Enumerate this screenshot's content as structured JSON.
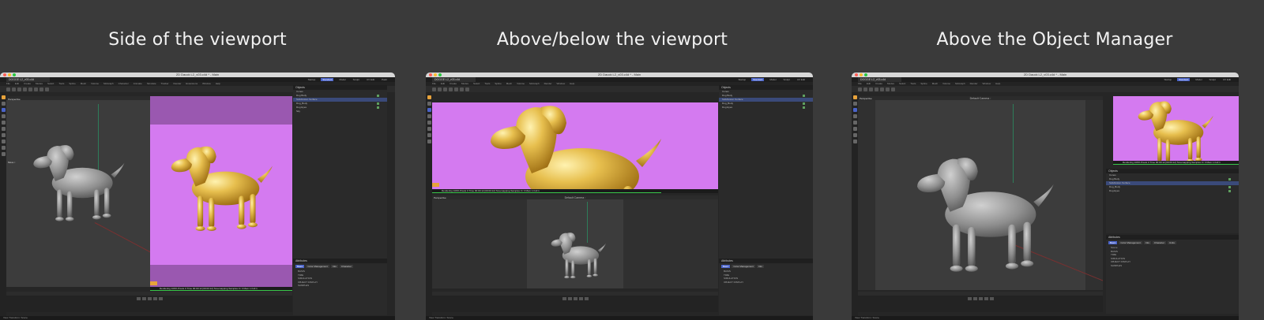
{
  "panels": [
    {
      "caption": "Side of the viewport"
    },
    {
      "caption": "Above/below the viewport"
    },
    {
      "caption": "Above the Object Manager"
    }
  ],
  "app": {
    "window_title": "2D Dauck L2_v03.c4d * - Main",
    "file_tab": "DOGGE L2_v03.c4d",
    "menus": [
      "File",
      "Edit",
      "Create",
      "Modes",
      "Select",
      "Tools",
      "Spline",
      "Mesh",
      "Volume",
      "MoGraph",
      "Character",
      "Animate",
      "Simulate",
      "Tracker",
      "Render",
      "Extensions",
      "Window",
      "Help"
    ],
    "layouts": [
      "Startup",
      "Standard",
      "Model",
      "Sculpt",
      "UV Edit",
      "Paint",
      "Groom",
      "Track",
      "Script",
      "Nodes"
    ],
    "active_layout": "Standard"
  },
  "viewport": {
    "view_label": "Perspective",
    "camera_label": "Default Camera ◦",
    "move_label": "Move ↕",
    "status": "View Transform: Scene",
    "grid_spacing": "Grid Spacing : 50 cm"
  },
  "object_manager": {
    "title": "Objects",
    "menus": [
      "File",
      "Edit",
      "View",
      "Object",
      "Tags",
      "Bookmarks"
    ],
    "items": [
      "Cones",
      "Dog Body",
      "Subdivision Surface",
      "Dog_Body",
      "Dog Eyes",
      "Sky"
    ]
  },
  "attributes": {
    "title": "Attributes",
    "layers_tab": "Layers",
    "mode": "Mode",
    "tabs": [
      "Basic",
      "Color Management",
      "Info",
      "Character",
      "Units",
      "Animation",
      "Project",
      "Nodes",
      "Simulation",
      "To Do",
      "Cinema 4D"
    ],
    "active_tab": "Basic",
    "sections": [
      "Scene",
      "BASIS",
      "TIME",
      "FPS",
      "Project Time",
      "Min Time",
      "Max Time",
      "SIMULATION",
      "OBJECT DISPLAY",
      "SAMPLES"
    ]
  },
  "render_view": {
    "info": "Rendering 100%  Pixels 0  Time 00:00:12 [00:00:12]  Tonemapping  Samples 0 / 3  Mem 1  Full 1"
  },
  "colors": {
    "accent": "#4a63c9",
    "render_bg": "#d47af0",
    "progress": "#39c64a"
  }
}
